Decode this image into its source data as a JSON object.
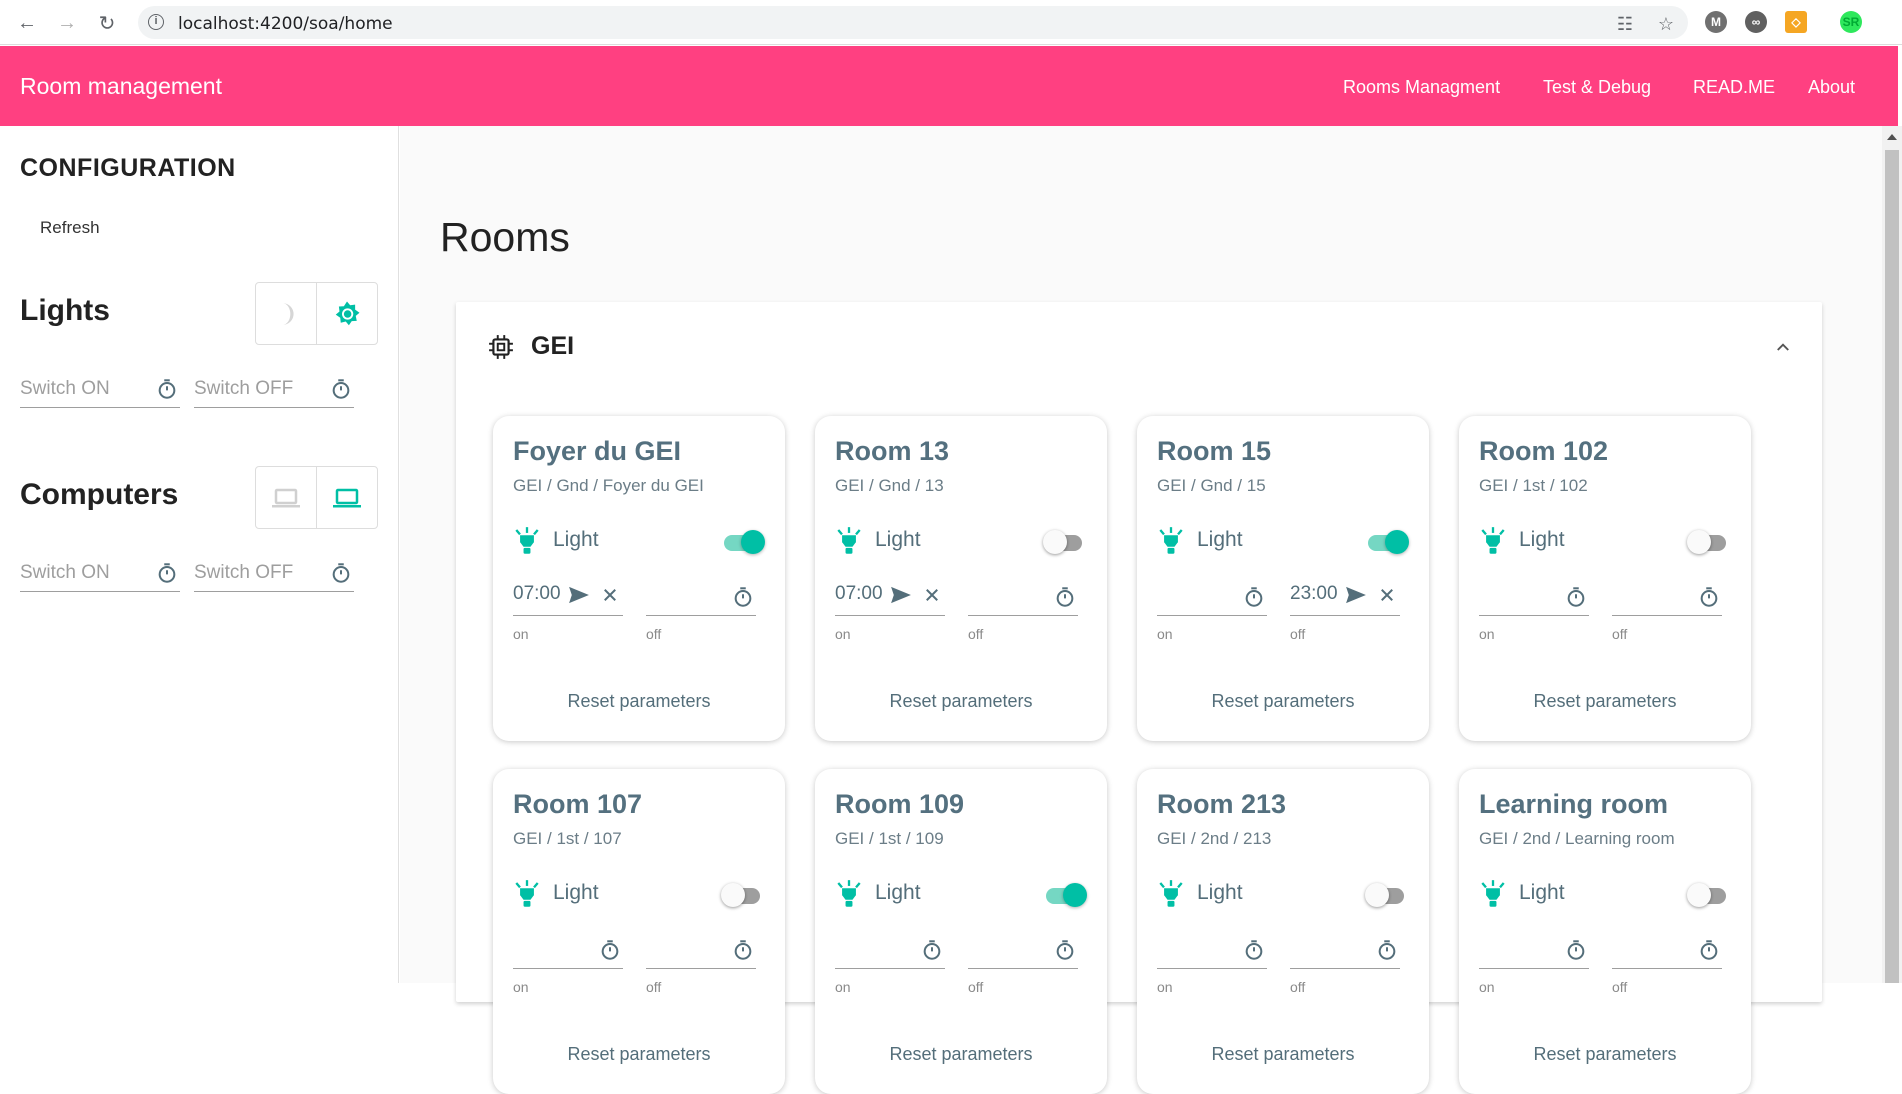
{
  "browser": {
    "url": "localhost:4200/soa/home",
    "profile_initials": "SR"
  },
  "app": {
    "title": "Room management",
    "nav": [
      "Rooms Managment",
      "Test & Debug",
      "READ.ME",
      "About"
    ]
  },
  "sidebar": {
    "config_title": "CONFIGURATION",
    "refresh_label": "Refresh",
    "lights": {
      "title": "Lights",
      "switch_on_placeholder": "Switch ON",
      "switch_off_placeholder": "Switch OFF"
    },
    "computers": {
      "title": "Computers",
      "switch_on_placeholder": "Switch ON",
      "switch_off_placeholder": "Switch OFF"
    }
  },
  "main": {
    "page_title": "Rooms",
    "panel_title": "GEI",
    "rooms": [
      {
        "name": "Foyer du GEI",
        "path": "GEI / Gnd / Foyer du GEI",
        "light_label": "Light",
        "light_on": true,
        "on_time": "07:00",
        "off_time": "",
        "on_hint": "on",
        "off_hint": "off",
        "reset_label": "Reset parameters"
      },
      {
        "name": "Room 13",
        "path": "GEI / Gnd / 13",
        "light_label": "Light",
        "light_on": false,
        "on_time": "07:00",
        "off_time": "",
        "on_hint": "on",
        "off_hint": "off",
        "reset_label": "Reset parameters"
      },
      {
        "name": "Room 15",
        "path": "GEI / Gnd / 15",
        "light_label": "Light",
        "light_on": true,
        "on_time": "",
        "off_time": "23:00",
        "on_hint": "on",
        "off_hint": "off",
        "reset_label": "Reset parameters"
      },
      {
        "name": "Room 102",
        "path": "GEI / 1st / 102",
        "light_label": "Light",
        "light_on": false,
        "on_time": "",
        "off_time": "",
        "on_hint": "on",
        "off_hint": "off",
        "reset_label": "Reset parameters"
      },
      {
        "name": "Room 107",
        "path": "GEI / 1st / 107",
        "light_label": "Light",
        "light_on": false,
        "on_time": "",
        "off_time": "",
        "on_hint": "on",
        "off_hint": "off",
        "reset_label": "Reset parameters"
      },
      {
        "name": "Room 109",
        "path": "GEI / 1st / 109",
        "light_label": "Light",
        "light_on": true,
        "on_time": "",
        "off_time": "",
        "on_hint": "on",
        "off_hint": "off",
        "reset_label": "Reset parameters"
      },
      {
        "name": "Room 213",
        "path": "GEI / 2nd / 213",
        "light_label": "Light",
        "light_on": false,
        "on_time": "",
        "off_time": "",
        "on_hint": "on",
        "off_hint": "off",
        "reset_label": "Reset parameters"
      },
      {
        "name": "Learning room",
        "path": "GEI / 2nd / Learning room",
        "light_label": "Light",
        "light_on": false,
        "on_time": "",
        "off_time": "",
        "on_hint": "on",
        "off_hint": "off",
        "reset_label": "Reset parameters"
      }
    ]
  },
  "colors": {
    "toolbar": "#ff4081",
    "accent": "#00bfa5",
    "card_text": "#54707f"
  }
}
